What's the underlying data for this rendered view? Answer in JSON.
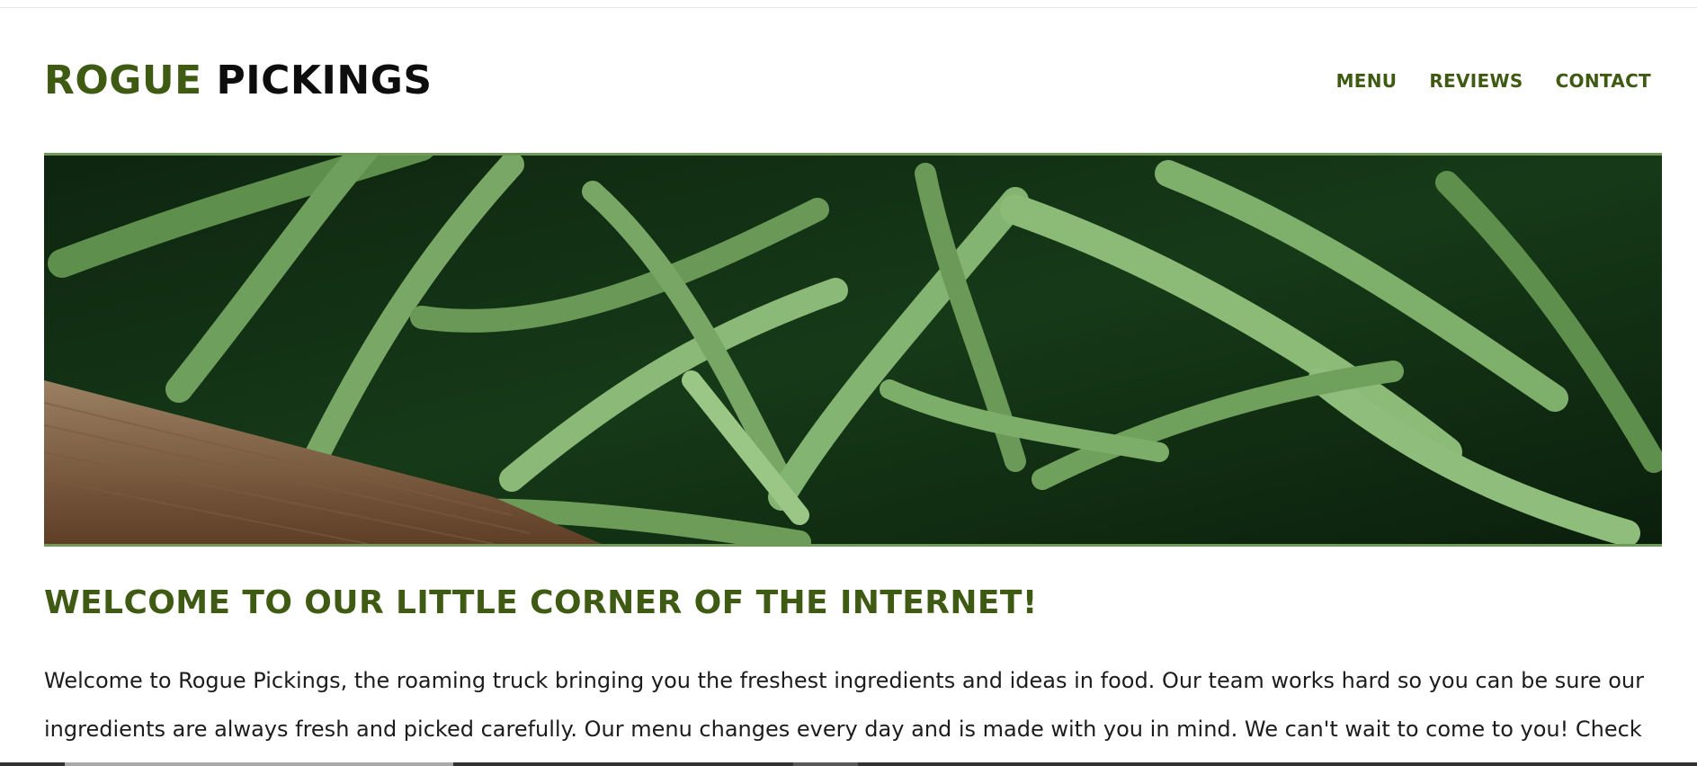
{
  "header": {
    "brand_part_1": "ROGUE",
    "brand_part_2": "PICKINGS",
    "nav": [
      "MENU",
      "REVIEWS",
      "CONTACT"
    ]
  },
  "main": {
    "heading": "WELCOME TO OUR LITTLE CORNER OF THE INTERNET!",
    "intro": "Welcome to Rogue Pickings, the roaming truck bringing you the freshest ingredients and ideas in food. Our team works hard so you can be sure our ingredients are always fresh and picked carefully. Our menu changes every day and is made with you in mind. We can't wait to come to you! Check"
  },
  "colors": {
    "accent": "#3f5a12",
    "hero_border": "#6f9a5a",
    "text": "#1c1c1c"
  }
}
